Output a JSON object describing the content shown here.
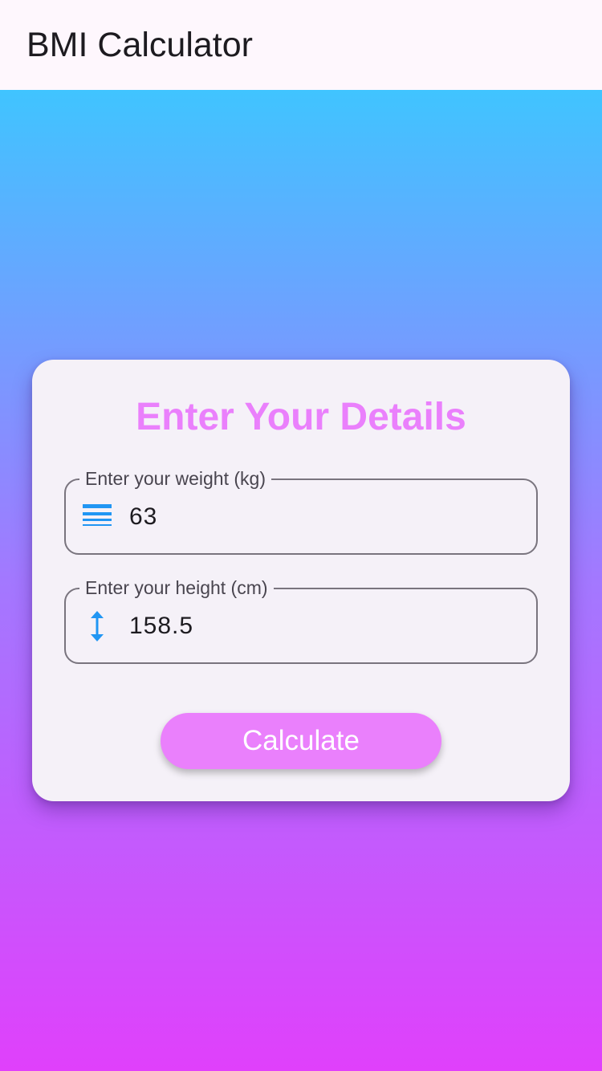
{
  "app_bar": {
    "title": "BMI Calculator"
  },
  "card": {
    "title": "Enter Your Details",
    "weight_field": {
      "label": "Enter your weight (kg)",
      "value": "63",
      "icon": "line-weight-icon"
    },
    "height_field": {
      "label": "Enter your height (cm)",
      "value": "158.5",
      "icon": "height-arrows-icon"
    },
    "calculate_label": "Calculate"
  },
  "colors": {
    "accent": "#ea80fc",
    "icon": "#2196f3",
    "gradient_top": "#40c4ff",
    "gradient_bottom": "#e040fb",
    "app_bar_bg": "#fef7fd",
    "card_bg": "#f5f1f8",
    "outline": "#79747e"
  }
}
